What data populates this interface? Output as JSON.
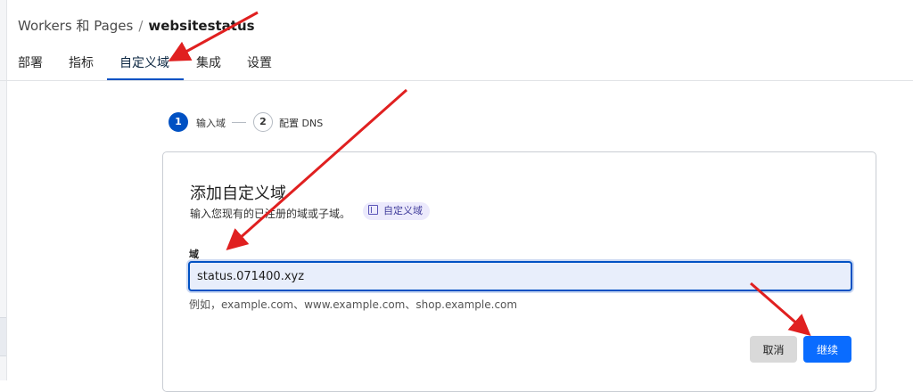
{
  "breadcrumb": {
    "parent": "Workers 和 Pages",
    "separator": "/",
    "current": "websitestatus"
  },
  "tabs": [
    {
      "label": "部署",
      "active": false
    },
    {
      "label": "指标",
      "active": false
    },
    {
      "label": "自定义域",
      "active": true
    },
    {
      "label": "集成",
      "active": false
    },
    {
      "label": "设置",
      "active": false
    }
  ],
  "steps": [
    {
      "number": "1",
      "label": "输入域",
      "active": true
    },
    {
      "number": "2",
      "label": "配置 DNS",
      "active": false
    }
  ],
  "card": {
    "title": "添加自定义域",
    "subtitle": "输入您现有的已注册的域或子域。",
    "doc_badge": "自定义域",
    "field_label": "域",
    "field_value": "status.071400.xyz",
    "field_hint": "例如，example.com、www.example.com、shop.example.com",
    "cancel_label": "取消",
    "continue_label": "继续"
  },
  "colors": {
    "accent": "#0051c3",
    "primary_button": "#0a6cff",
    "annotation_arrow": "#e02020"
  },
  "icons": {
    "doc_badge_icon": "document-icon"
  }
}
